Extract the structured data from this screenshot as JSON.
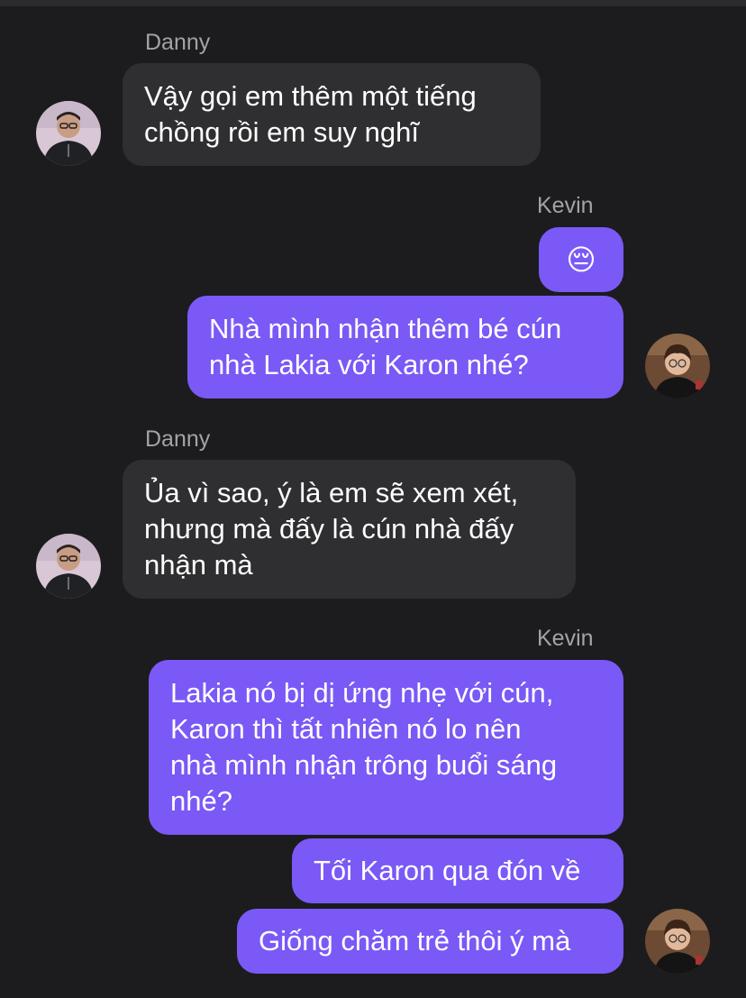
{
  "colors": {
    "background": "#1c1c1e",
    "incoming_bubble": "#2f2f31",
    "outgoing_bubble": "#7a59f6",
    "sender_name": "#a3a3a8",
    "text": "#ffffff"
  },
  "messages": [
    {
      "sender": "Danny",
      "lines": [
        "Vậy gọi em thêm một tiếng",
        "chồng rồi em suy nghĩ"
      ]
    },
    {
      "sender": "Kevin",
      "lines": [
        "😔"
      ]
    },
    {
      "lines": [
        "Nhà mình nhận thêm bé cún",
        "nhà Lakia với Karon nhé?"
      ]
    },
    {
      "sender": "Danny",
      "lines": [
        "Ủa vì sao, ý là em sẽ xem xét,",
        "nhưng mà đấy là cún nhà đấy",
        "nhận mà"
      ]
    },
    {
      "sender": "Kevin",
      "lines": [
        "Lakia nó bị dị ứng nhẹ với cún,",
        "Karon thì tất nhiên nó lo nên",
        "nhà mình nhận trông buổi sáng",
        "nhé?"
      ]
    },
    {
      "lines": [
        "Tối Karon qua đón về"
      ]
    },
    {
      "lines": [
        "Giống chăm trẻ thôi ý mà"
      ]
    }
  ],
  "avatars": {
    "danny": "avatar-danny",
    "kevin": "avatar-kevin"
  }
}
